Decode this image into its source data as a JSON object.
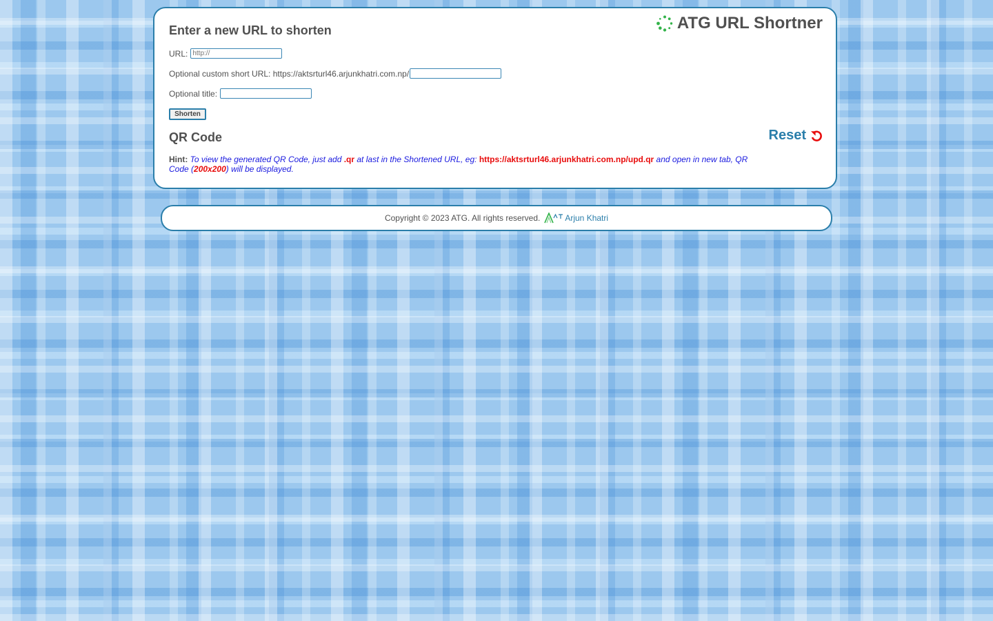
{
  "app": {
    "title": "ATG URL Shortner",
    "logo_icon": "spinner-dots-icon",
    "accent_color": "#2a7eaa",
    "logo_color": "#33b34a"
  },
  "form": {
    "heading": "Enter a new URL to shorten",
    "url_label": "URL:",
    "url_placeholder": "http://",
    "custom_label": "Optional custom short URL: https://aktsrturl46.arjunkhatri.com.np/",
    "custom_value": "",
    "title_label": "Optional title:",
    "title_value": "",
    "submit_label": "Shorten"
  },
  "qr": {
    "heading": "QR Code",
    "reset_label": "Reset",
    "reset_icon": "undo-icon",
    "reset_icon_color": "#e80c0c",
    "hint_label": "Hint:",
    "hint_text_1": "To view the generated QR Code, just add ",
    "hint_ext": ".qr",
    "hint_text_2": " at last in the Shortened URL, eg: ",
    "hint_example": "https://aktsrturl46.arjunkhatri.com.np/upd.qr",
    "hint_text_3": " and open in new tab, QR Code (",
    "hint_size": "200x200",
    "hint_text_4": ") will be displayed."
  },
  "footer": {
    "copyright": "Copyright © 2023 ATG. All rights reserved.",
    "author_logo": "atg-logo-icon",
    "author_name": "Arjun Khatri"
  }
}
